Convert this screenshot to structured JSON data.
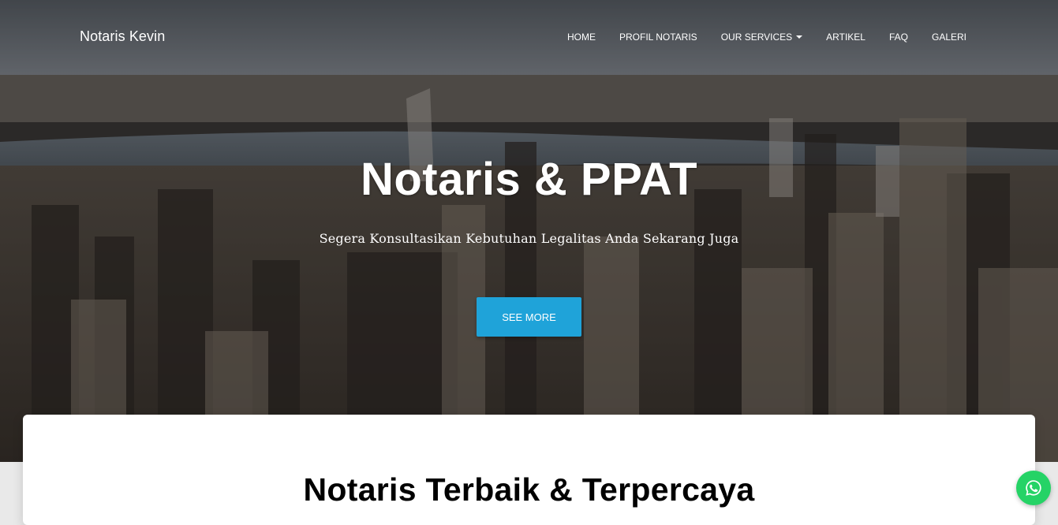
{
  "navbar": {
    "brand": "Notaris Kevin",
    "items": [
      {
        "label": "HOME",
        "dropdown": false
      },
      {
        "label": "PROFIL NOTARIS",
        "dropdown": false
      },
      {
        "label": "OUR SERVICES",
        "dropdown": true
      },
      {
        "label": "ARTIKEL",
        "dropdown": false
      },
      {
        "label": "FAQ",
        "dropdown": false
      },
      {
        "label": "GALERI",
        "dropdown": false
      }
    ]
  },
  "hero": {
    "title": "Notaris & PPAT",
    "subtitle": "Segera Konsultasikan Kebutuhan Legalitas Anda Sekarang Juga",
    "button_label": "SEE MORE"
  },
  "content": {
    "section_title": "Notaris Terbaik & Terpercaya"
  },
  "floating": {
    "icon": "whatsapp-icon"
  },
  "colors": {
    "accent": "#1fa3d9",
    "whatsapp": "#25d366"
  }
}
